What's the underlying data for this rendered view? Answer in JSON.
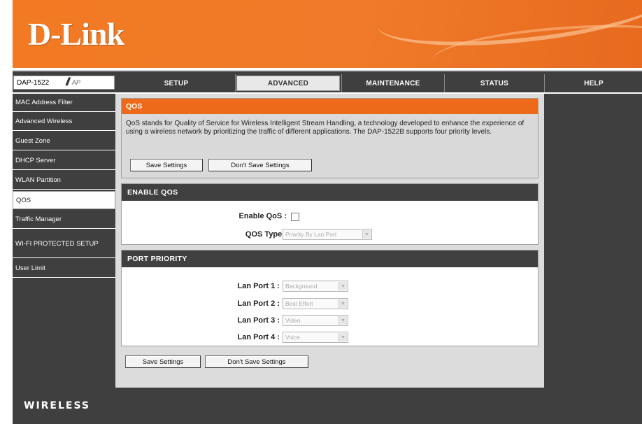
{
  "brand": {
    "logo_text": "D-Link",
    "color_orange": "#ec6a1a",
    "color_dark": "#404040"
  },
  "nav": {
    "model": "DAP-1522",
    "mode": "AP",
    "tabs": [
      {
        "label": "SETUP",
        "active": false
      },
      {
        "label": "ADVANCED",
        "active": true
      },
      {
        "label": "MAINTENANCE",
        "active": false
      },
      {
        "label": "STATUS",
        "active": false
      },
      {
        "label": "HELP",
        "active": false
      }
    ]
  },
  "sidebar": {
    "items": [
      {
        "label": "MAC Address Filter",
        "active": false
      },
      {
        "label": "Advanced Wireless",
        "active": false
      },
      {
        "label": "Guest Zone",
        "active": false
      },
      {
        "label": "DHCP Server",
        "active": false
      },
      {
        "label": "WLAN Partition",
        "active": false
      },
      {
        "label": "QOS",
        "active": true
      },
      {
        "label": "Traffic Manager",
        "active": false
      },
      {
        "label": "WI-FI PROTECTED SETUP",
        "active": false
      },
      {
        "label": "User Limit",
        "active": false
      }
    ]
  },
  "qos": {
    "title": "QOS",
    "description": "QoS stands for Quality of Service for Wireless Intelligent Stream Handling, a technology developed to enhance the experience of using a wireless network by prioritizing the traffic of different applications. The DAP-1522B supports four priority levels.",
    "save_label": "Save Settings",
    "dont_save_label": "Don't Save Settings"
  },
  "enable_qos": {
    "title": "ENABLE QOS",
    "enable_label": "Enable QoS :",
    "enable_checked": false,
    "type_label": "QOS Type :",
    "type_value": "Priority By Lan Port"
  },
  "port_priority": {
    "title": "PORT PRIORITY",
    "ports": [
      {
        "label": "Lan Port 1 :",
        "value": "Background"
      },
      {
        "label": "Lan Port 2 :",
        "value": "Best Effort"
      },
      {
        "label": "Lan Port 3 :",
        "value": "Video"
      },
      {
        "label": "Lan Port 4 :",
        "value": "Voice"
      }
    ],
    "save_label": "Save Settings",
    "dont_save_label": "Don't Save Settings"
  },
  "footer": {
    "label": "WIRELESS"
  }
}
